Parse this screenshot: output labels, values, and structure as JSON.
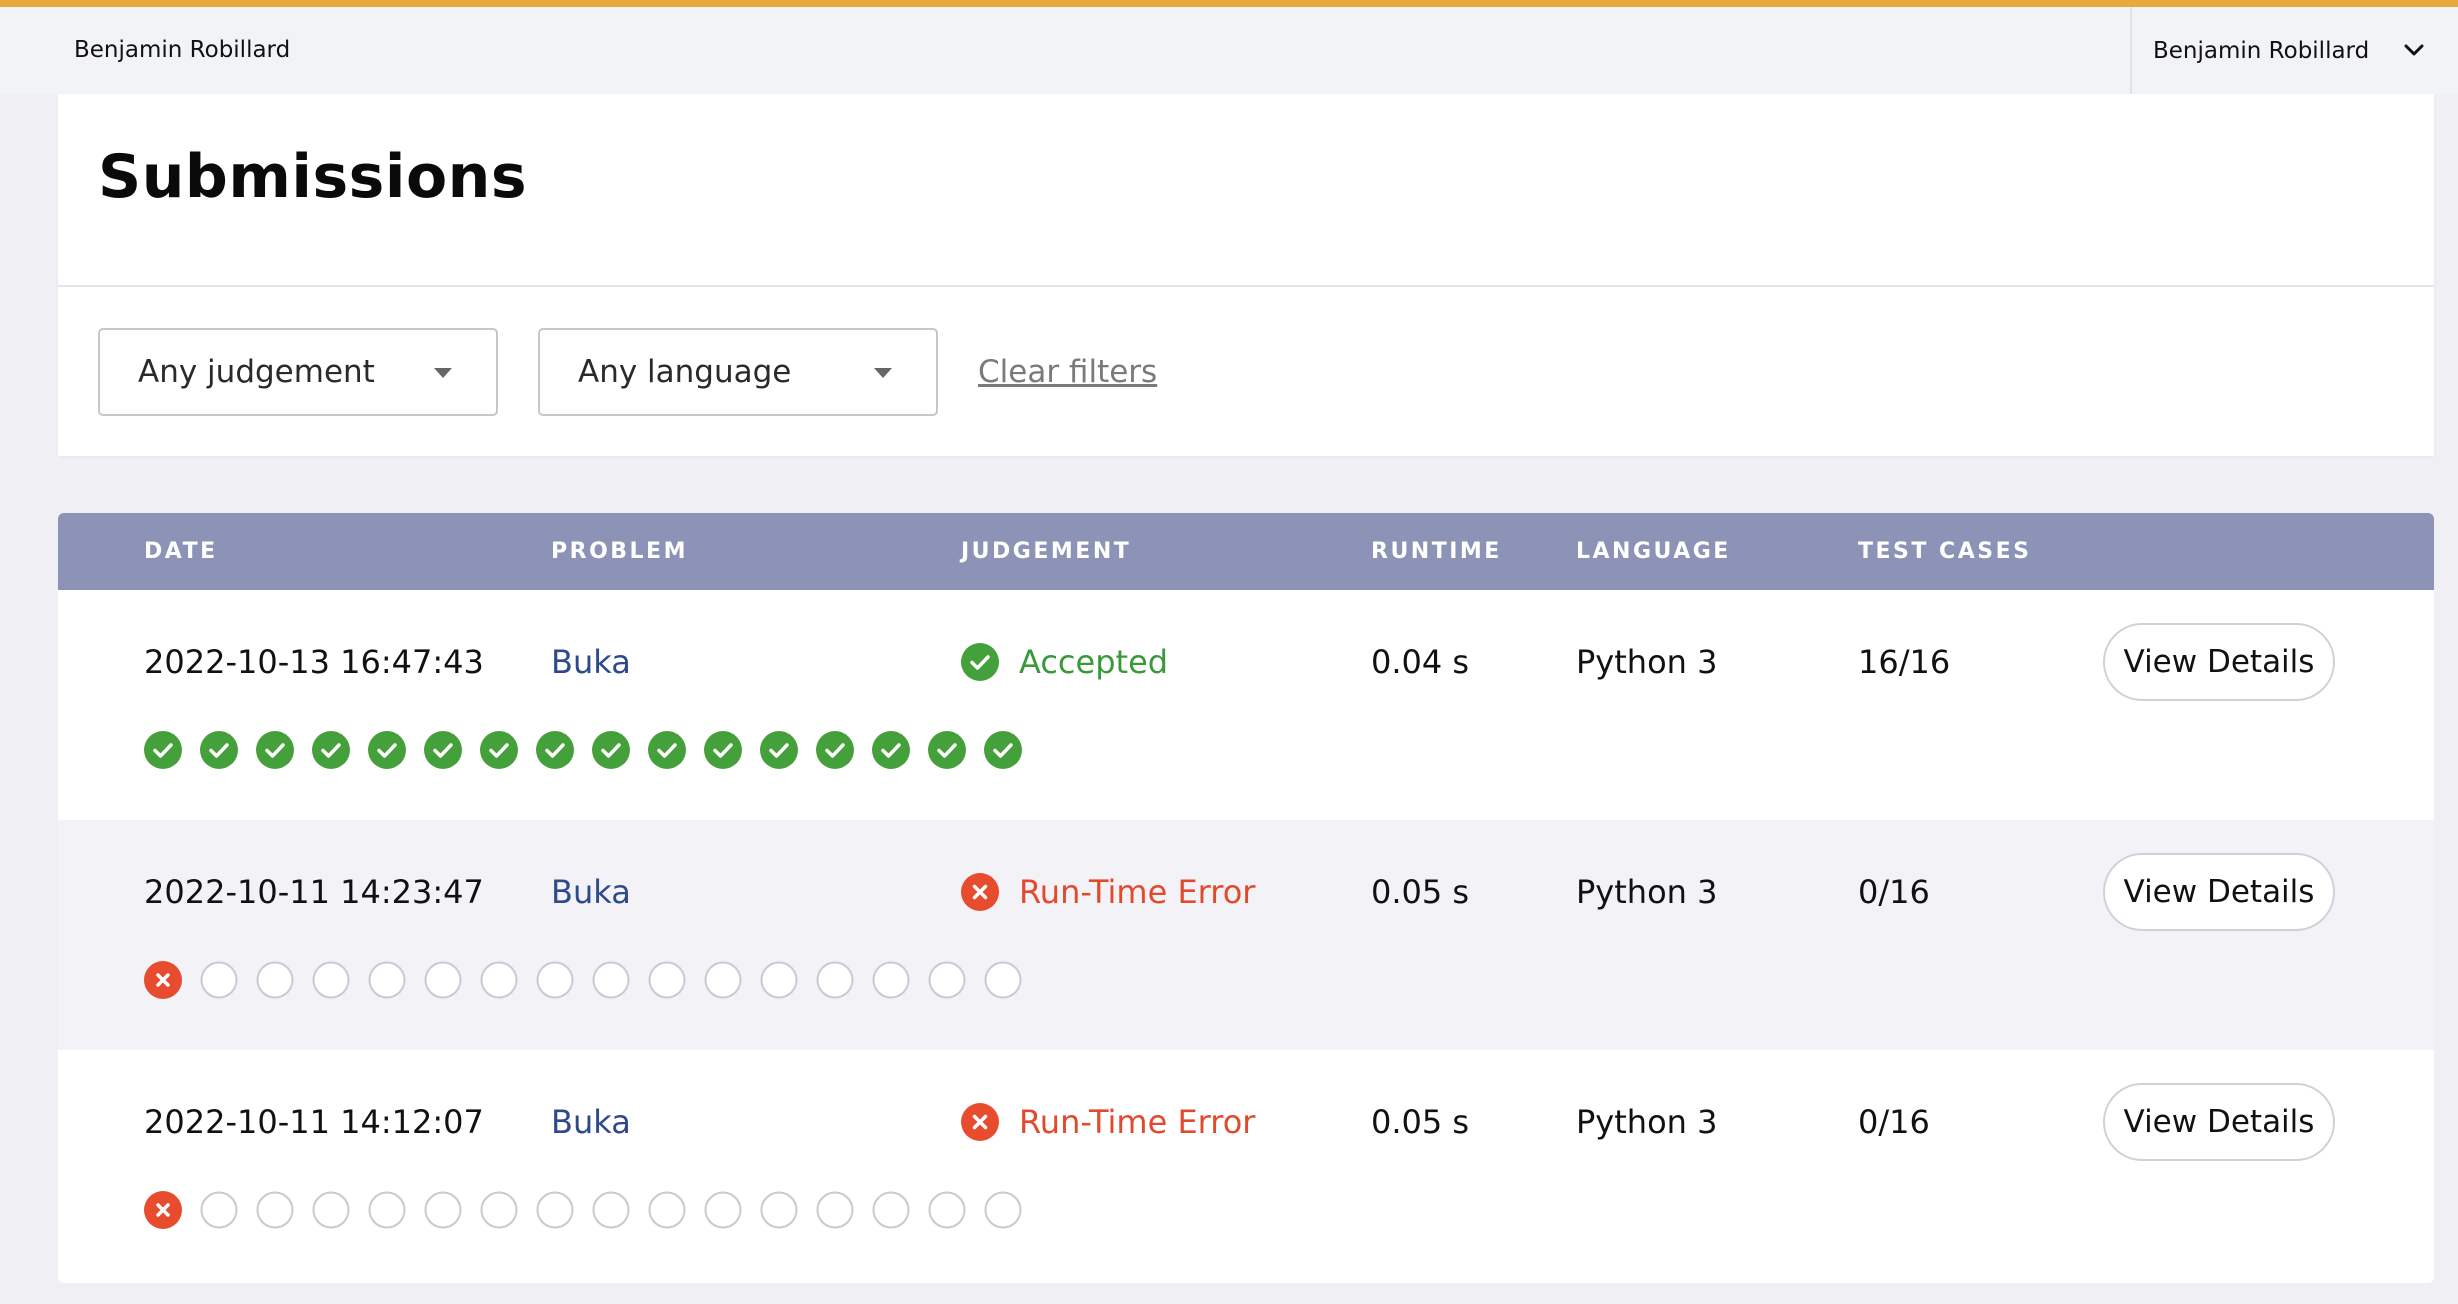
{
  "colors": {
    "accent": "#e6a93e",
    "header": "#8c93b6",
    "accepted": "#43a03a",
    "error": "#e74c2f",
    "link": "#2f4a8a"
  },
  "topbar": {
    "left_user": "Benjamin Robillard",
    "menu_user": "Benjamin Robillard",
    "menu_icon": "chevron-down-icon"
  },
  "page": {
    "title": "Submissions"
  },
  "filters": {
    "judgement": "Any judgement",
    "language": "Any language",
    "clear": "Clear filters"
  },
  "table": {
    "columns": [
      "DATE",
      "PROBLEM",
      "JUDGEMENT",
      "RUNTIME",
      "LANGUAGE",
      "TEST CASES"
    ],
    "rows": [
      {
        "date": "2022-10-13 16:47:43",
        "problem": "Buka",
        "judgement": "Accepted",
        "status": "accepted",
        "runtime": "0.04 s",
        "language": "Python 3",
        "test_cases": "16/16",
        "action": "View Details",
        "cases": [
          "pass",
          "pass",
          "pass",
          "pass",
          "pass",
          "pass",
          "pass",
          "pass",
          "pass",
          "pass",
          "pass",
          "pass",
          "pass",
          "pass",
          "pass",
          "pass"
        ]
      },
      {
        "date": "2022-10-11 14:23:47",
        "problem": "Buka",
        "judgement": "Run-Time Error",
        "status": "error",
        "runtime": "0.05 s",
        "language": "Python 3",
        "test_cases": "0/16",
        "action": "View Details",
        "cases": [
          "fail",
          "none",
          "none",
          "none",
          "none",
          "none",
          "none",
          "none",
          "none",
          "none",
          "none",
          "none",
          "none",
          "none",
          "none",
          "none"
        ]
      },
      {
        "date": "2022-10-11 14:12:07",
        "problem": "Buka",
        "judgement": "Run-Time Error",
        "status": "error",
        "runtime": "0.05 s",
        "language": "Python 3",
        "test_cases": "0/16",
        "action": "View Details",
        "cases": [
          "fail",
          "none",
          "none",
          "none",
          "none",
          "none",
          "none",
          "none",
          "none",
          "none",
          "none",
          "none",
          "none",
          "none",
          "none",
          "none"
        ]
      }
    ]
  }
}
